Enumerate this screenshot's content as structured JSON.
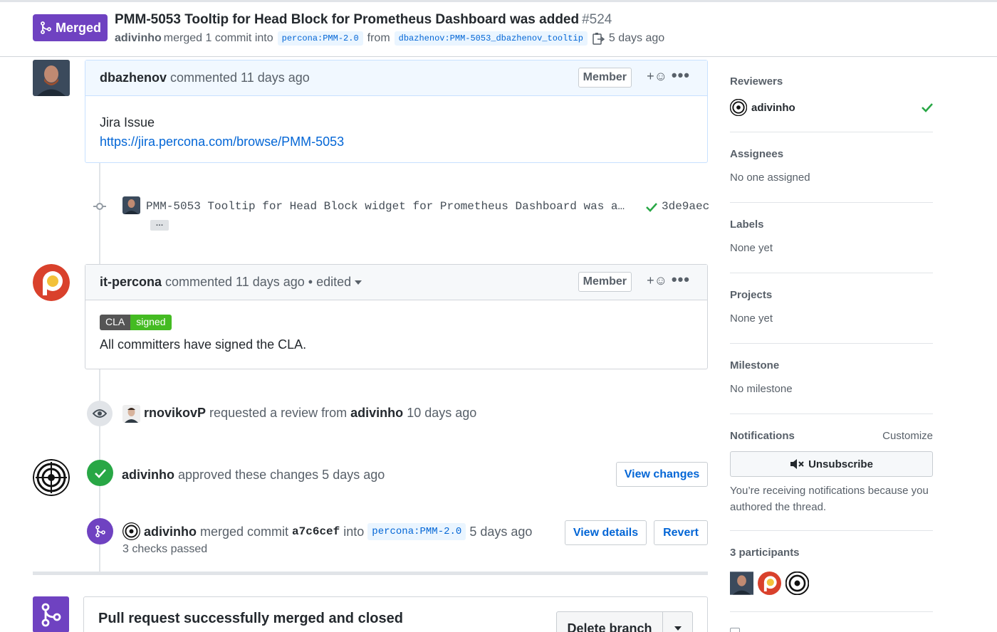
{
  "header": {
    "status": "Merged",
    "title": "PMM-5053 Tooltip for Head Block for Prometheus Dashboard was added",
    "number": "#524",
    "author": "adivinho",
    "merged_text": "merged 1 commit into",
    "base_branch": "percona:PMM-2.0",
    "from_text": "from",
    "head_branch": "dbazhenov:PMM-5053_dbazhenov_tooltip",
    "time": "5 days ago"
  },
  "comment1": {
    "author": "dbazhenov",
    "meta": "commented 11 days ago",
    "role": "Member",
    "react": "+☺",
    "more": "•••",
    "body_line1": "Jira Issue",
    "body_link": "https://jira.percona.com/browse/PMM-5053"
  },
  "commit": {
    "message": "PMM-5053 Tooltip for Head Block widget for Prometheus Dashboard was a…",
    "expand": "…",
    "sha": "3de9aec"
  },
  "comment2": {
    "author": "it-percona",
    "meta": "commented 11 days ago • edited",
    "role": "Member",
    "react": "+☺",
    "more": "•••",
    "cla_left": "CLA",
    "cla_right": "signed",
    "body": "All committers have signed the CLA."
  },
  "review_request": {
    "actor": "rnovikovP",
    "text": "requested a review from",
    "target": "adivinho",
    "time": "10 days ago"
  },
  "approval": {
    "actor": "adivinho",
    "text": "approved these changes 5 days ago",
    "button": "View changes"
  },
  "merge_event": {
    "actor": "adivinho",
    "text": "merged commit",
    "sha": "a7c6cef",
    "into": "into",
    "branch": "percona:PMM-2.0",
    "time": "5 days ago",
    "checks": "3 checks passed",
    "view_details": "View details",
    "revert": "Revert"
  },
  "footer": {
    "title": "Pull request successfully merged and closed",
    "delete_branch": "Delete branch"
  },
  "sidebar": {
    "reviewers_title": "Reviewers",
    "reviewer": "adivinho",
    "assignees_title": "Assignees",
    "assignees_value": "No one assigned",
    "labels_title": "Labels",
    "labels_value": "None yet",
    "projects_title": "Projects",
    "projects_value": "None yet",
    "milestone_title": "Milestone",
    "milestone_value": "No milestone",
    "notifications_title": "Notifications",
    "customize": "Customize",
    "unsubscribe": "Unsubscribe",
    "notif_reason": "You’re receiving notifications because you authored the thread.",
    "participants_title": "3 participants"
  },
  "colors": {
    "merged": "#6f42c1",
    "approved": "#2cbe4e",
    "link": "#0366d6"
  }
}
